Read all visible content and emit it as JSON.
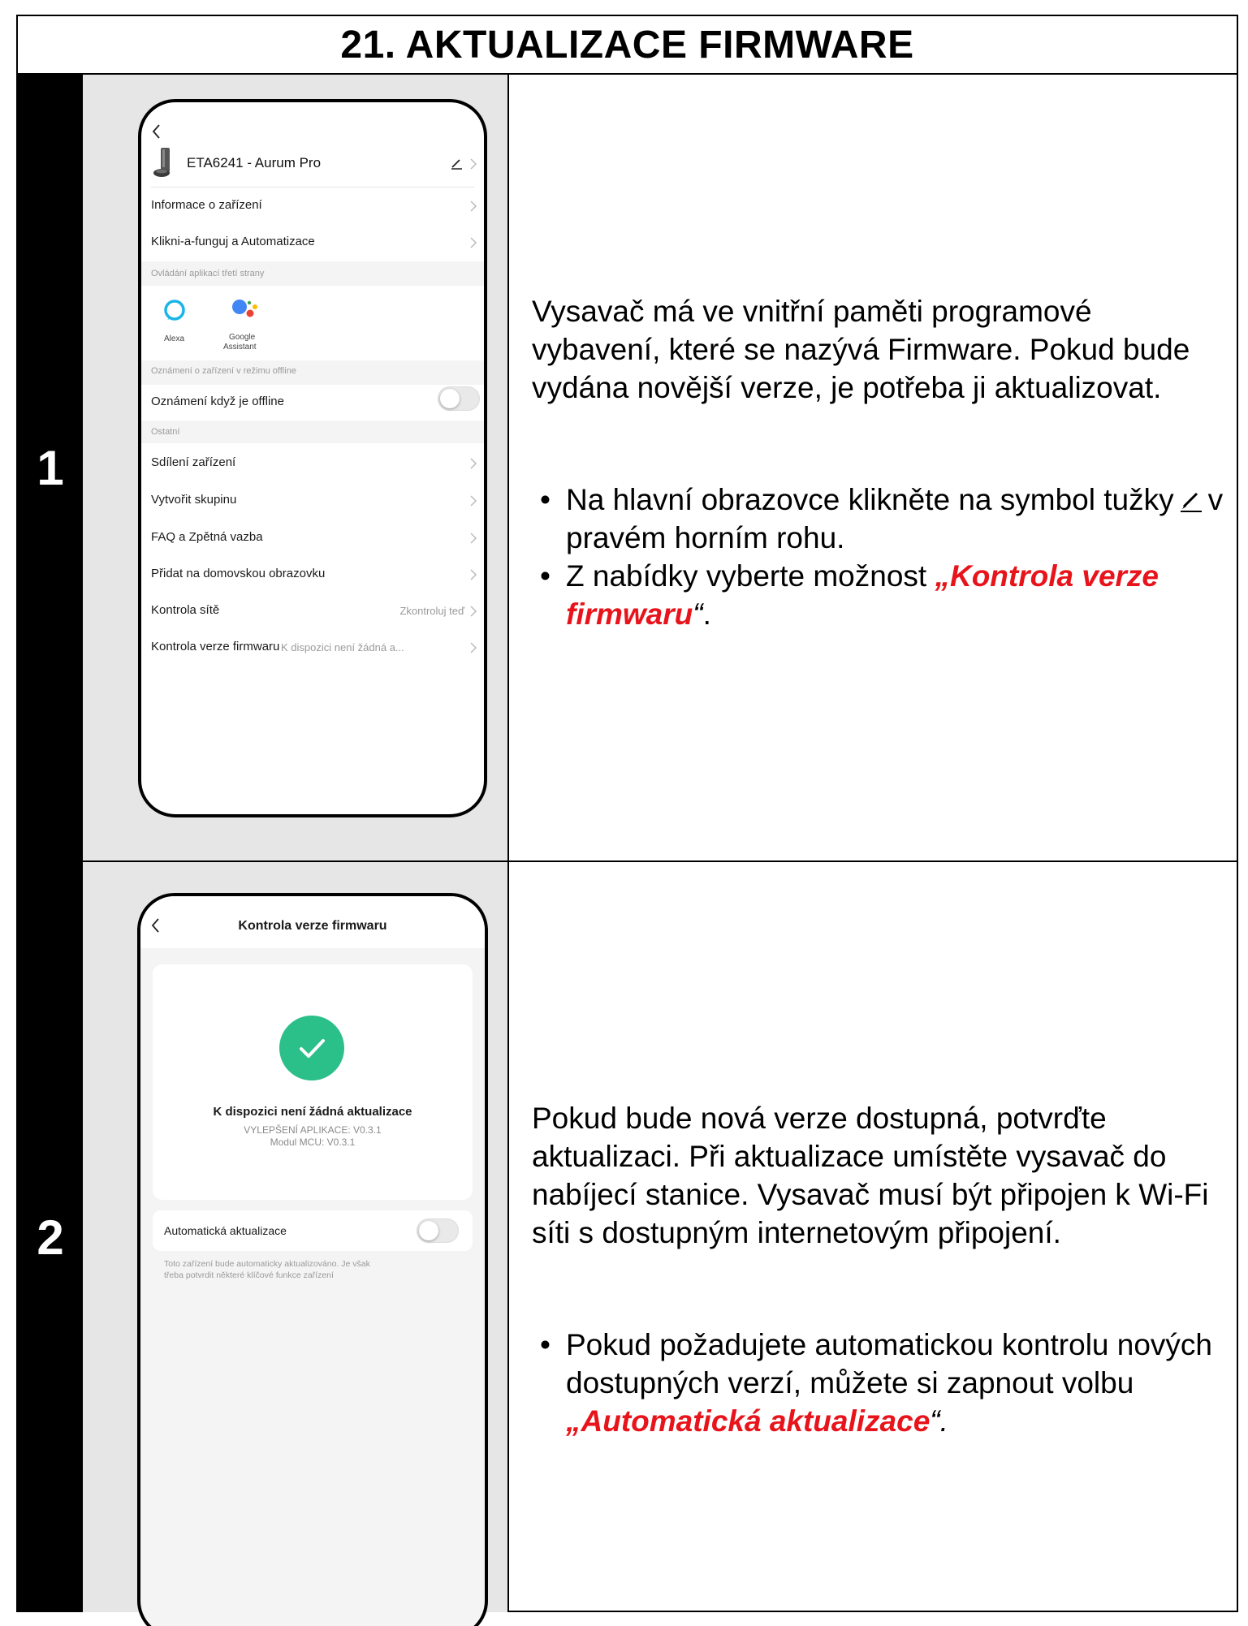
{
  "title": "21. AKTUALIZACE FIRMWARE",
  "step1": {
    "number": "1",
    "paragraph": "Vysavač má ve vnitřní paměti programové vybavení, které se nazývá Firmware. Pokud bude vydána novější verze, je potřeba ji aktualizovat.",
    "bullet1_before": "Na hlavní obrazovce klikněte na symbol tužky",
    "bullet1_after": "v pravém horním rohu.",
    "bullet2_before": "Z nabídky vyberte možnost ",
    "bullet2_open_quote": "„",
    "bullet2_highlight": "Kontrola verze firmwaru",
    "bullet2_close_quote": "“",
    "bullet2_end": ".",
    "phone": {
      "device_name": "ETA6241 - Aurum Pro",
      "menu_info": "Informace o zařízení",
      "menu_automation": "Klikni-a-funguj a Automatizace",
      "section_third_party": "Ovládání aplikací třetí strany",
      "alexa_label": "Alexa",
      "google_label_1": "Google",
      "google_label_2": "Assistant",
      "section_offline": "Oznámení o zařízení v režimu offline",
      "offline_notify": "Oznámení když je offline",
      "section_other": "Ostatní",
      "menu_share": "Sdílení zařízení",
      "menu_group": "Vytvořit skupinu",
      "menu_faq": "FAQ a Zpětná vazba",
      "menu_home": "Přidat na domovskou obrazovku",
      "menu_network": "Kontrola sítě",
      "network_value": "Zkontroluj teď",
      "menu_firmware": "Kontrola verze firmwaru",
      "firmware_value": "K dispozici není žádná a..."
    }
  },
  "step2": {
    "number": "2",
    "paragraph": "Pokud bude nová verze dostupná, potvrďte aktualizaci. Při aktualizace umístěte vysavač do nabíjecí stanice. Vysavač musí být připojen k Wi-Fi síti s dostupným internetovým připojení.",
    "bullet_before": "Pokud požadujete automatickou kontrolu nových dostupných verzí, můžete si zapnout volbu ",
    "bullet_open_quote": "„",
    "bullet_highlight": "Automatická aktualizace",
    "bullet_close_quote": "“.",
    "phone": {
      "header": "Kontrola verze firmwaru",
      "status": "K dispozici není žádná aktualizace",
      "app_version": "VYLEPŠENÍ APLIKACE: V0.3.1",
      "mcu_version": "Modul MCU: V0.3.1",
      "auto_update": "Automatická aktualizace",
      "note_line1": "Toto zařízení bude automaticky aktualizováno. Je však",
      "note_line2": "třeba potvrdit některé klíčové funkce zařízení"
    }
  },
  "colors": {
    "highlight": "#e8141b",
    "check_green": "#2bbf8a",
    "google_blue": "#4285f4",
    "alexa_cyan": "#1ab5e8"
  }
}
